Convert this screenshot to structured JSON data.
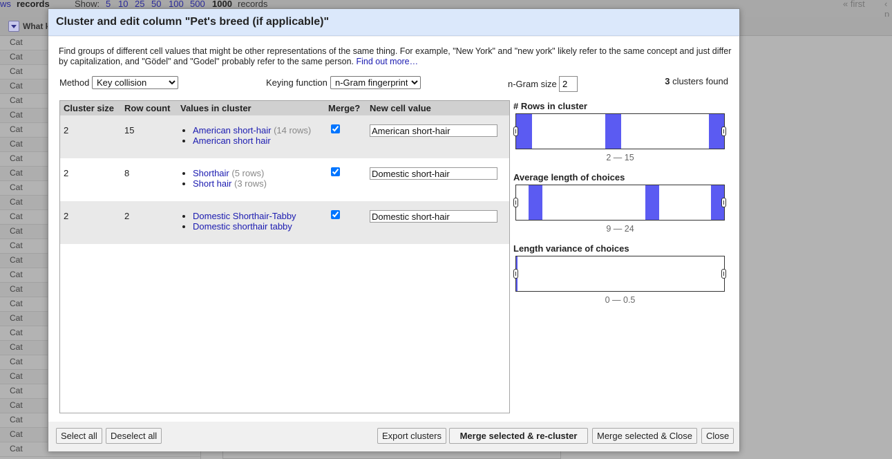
{
  "background": {
    "topbar": {
      "rows_frag": "ws",
      "records_label": "records",
      "show_label": "Show:",
      "page_sizes": [
        "5",
        "10",
        "25",
        "50",
        "100",
        "500"
      ],
      "current_size": "1000",
      "records_suffix": "records",
      "first_link": "« first",
      "prev_frag": "‹ p"
    },
    "column_label": "What k",
    "row_value": "Cat"
  },
  "dialog": {
    "title": "Cluster and edit column \"Pet's breed (if applicable)\"",
    "description": "Find groups of different cell values that might be other representations of the same thing. For example, \"New York\" and \"new york\" likely refer to the same concept and just differ by capitalization, and \"Gödel\" and \"Godel\" probably refer to the same person.",
    "find_out_more": "Find out more…",
    "method_label": "Method",
    "method_value": "Key collision",
    "keying_label": "Keying function",
    "keying_value": "n-Gram fingerprint",
    "ngram_label": "n-Gram size",
    "ngram_value": "2",
    "clusters_count": "3",
    "clusters_found_label": "clusters found",
    "table": {
      "headers": {
        "cluster_size": "Cluster size",
        "row_count": "Row count",
        "values": "Values in cluster",
        "merge": "Merge?",
        "new_value": "New cell value"
      },
      "rows": [
        {
          "size": "2",
          "count": "15",
          "values": [
            {
              "text": "American short-hair",
              "rows": "(14 rows)"
            },
            {
              "text": "American short hair",
              "rows": ""
            }
          ],
          "merge": true,
          "new_value": "American short-hair"
        },
        {
          "size": "2",
          "count": "8",
          "values": [
            {
              "text": "Shorthair",
              "rows": "(5 rows)"
            },
            {
              "text": "Short hair",
              "rows": "(3 rows)"
            }
          ],
          "merge": true,
          "new_value": "Domestic short-hair"
        },
        {
          "size": "2",
          "count": "2",
          "values": [
            {
              "text": "Domestic Shorthair-Tabby",
              "rows": ""
            },
            {
              "text": "Domestic shorthair tabby",
              "rows": ""
            }
          ],
          "merge": true,
          "new_value": "Domestic short-hair"
        }
      ]
    },
    "facets": [
      {
        "title": "# Rows in cluster",
        "range": "2 — 15"
      },
      {
        "title": "Average length of choices",
        "range": "9 — 24"
      },
      {
        "title": "Length variance of choices",
        "range": "0 — 0.5"
      }
    ],
    "buttons": {
      "select_all": "Select all",
      "deselect_all": "Deselect all",
      "export": "Export clusters",
      "merge_recluster": "Merge selected & re-cluster",
      "merge_close": "Merge selected & Close",
      "close": "Close"
    },
    "colors": {
      "header_bg": "#dbe8fb",
      "histogram_bar": "#5b5bf2",
      "link": "#1a1ab0"
    }
  }
}
